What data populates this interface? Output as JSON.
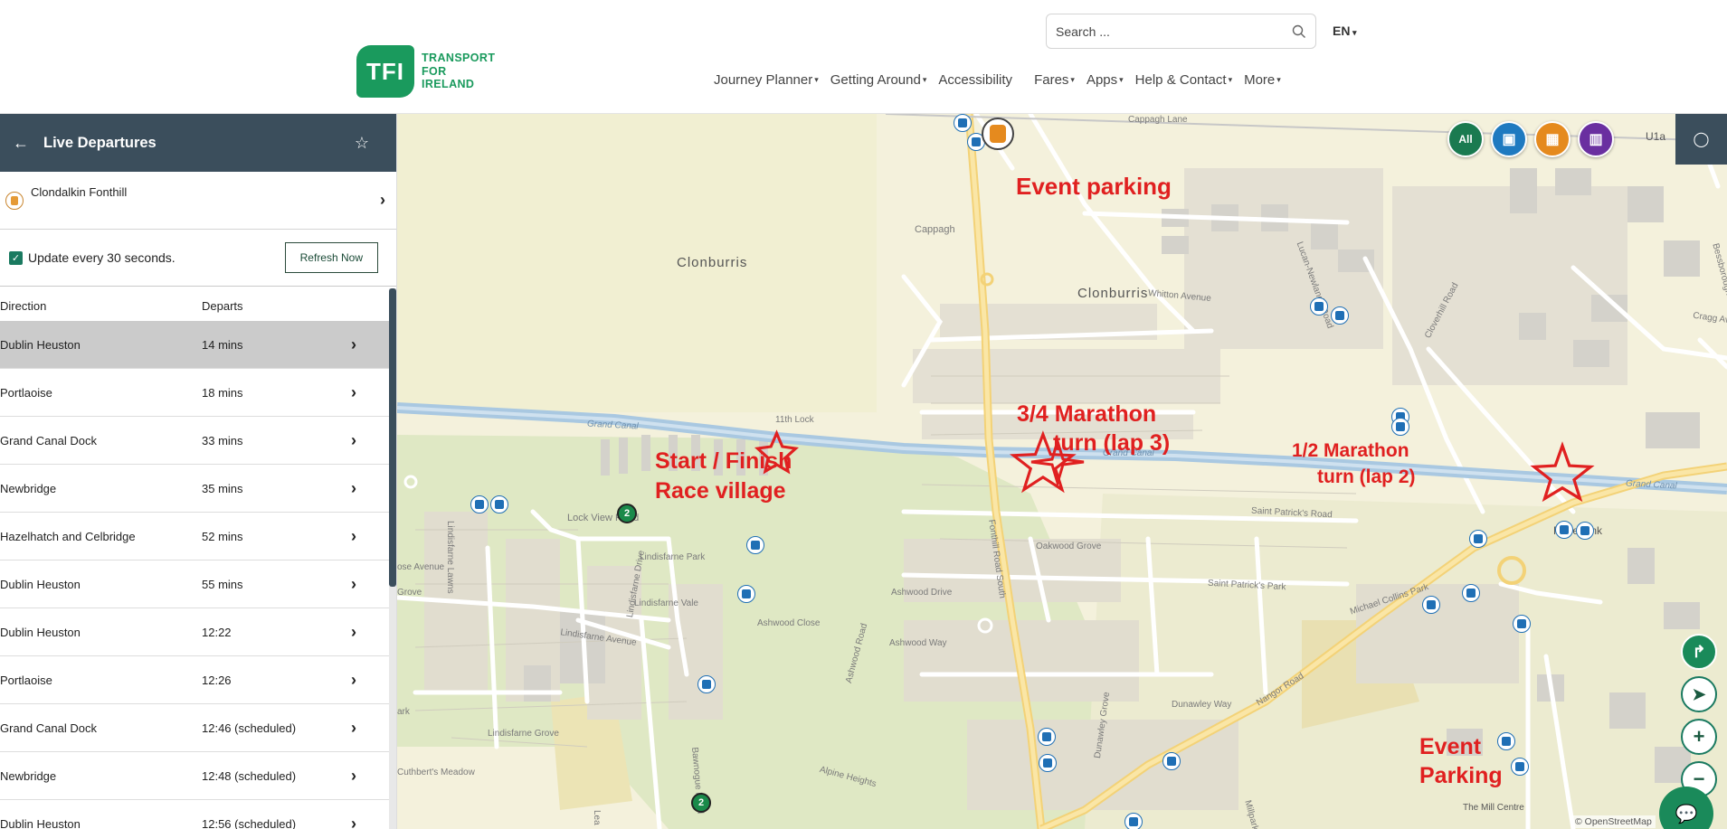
{
  "header": {
    "logo_badge": "TFI",
    "logo_lines": [
      "TRANSPORT",
      "FOR",
      "IRELAND"
    ],
    "search_placeholder": "Search ...",
    "language": "EN",
    "nav": [
      "Journey Planner",
      "Getting Around",
      "Accessibility",
      "Fares",
      "Apps",
      "Help & Contact",
      "More"
    ],
    "nav_has_caret": [
      true,
      true,
      false,
      true,
      true,
      true,
      true
    ]
  },
  "panel": {
    "title": "Live Departures",
    "stop_name": "Clondalkin Fonthill",
    "update_label": "Update every 30 seconds.",
    "refresh_label": "Refresh Now",
    "col_direction": "Direction",
    "col_departs": "Departs",
    "departures": [
      {
        "direction": "Dublin Heuston",
        "departs": "14 mins"
      },
      {
        "direction": "Portlaoise",
        "departs": "18 mins"
      },
      {
        "direction": "Grand Canal Dock",
        "departs": "33 mins"
      },
      {
        "direction": "Newbridge",
        "departs": "35 mins"
      },
      {
        "direction": "Hazelhatch and Celbridge",
        "departs": "52 mins"
      },
      {
        "direction": "Dublin Heuston",
        "departs": "55 mins"
      },
      {
        "direction": "Dublin Heuston",
        "departs": "12:22"
      },
      {
        "direction": "Portlaoise",
        "departs": "12:26"
      },
      {
        "direction": "Grand Canal Dock",
        "departs": "12:46 (scheduled)"
      },
      {
        "direction": "Newbridge",
        "departs": "12:48 (scheduled)"
      },
      {
        "direction": "Dublin Heuston",
        "departs": "12:56 (scheduled)"
      }
    ]
  },
  "map": {
    "mode_buttons": [
      {
        "label": "All",
        "color": "#1a7a50"
      },
      {
        "label": "",
        "icon": "bus-icon",
        "color": "#1f7ac0"
      },
      {
        "label": "",
        "icon": "train-icon",
        "color": "#e58a1e"
      },
      {
        "label": "",
        "icon": "tram-icon",
        "color": "#6a2fa0"
      }
    ],
    "annotations": {
      "event_parking_top": "Event parking",
      "three_quarter_l1": "3/4 Marathon",
      "three_quarter_l2": "turn (lap 3)",
      "half_l1": "1/2 Marathon",
      "half_l2": "turn (lap 2)",
      "start_l1": "Start / Finish",
      "start_l2": "Race village",
      "event_parking_bottom_l1": "Event",
      "event_parking_bottom_l2": "Parking"
    },
    "area_labels": [
      "Clonburris",
      "Clonburris",
      "Cappagh",
      "Rosebank"
    ],
    "street_labels": [
      "Grand Canal",
      "Grand Canal",
      "Grand Canal",
      "11th Lock",
      "Lock View Road",
      "Lindisfarne Park",
      "Lindisfarne Vale",
      "Lindisfarne Avenue",
      "Lindisfarne Grove",
      "Lindisfarne Lawns",
      "Lindisfarne Drive",
      "Ashwood Close",
      "Ashwood Drive",
      "Ashwood Way",
      "Ashwood Road",
      "Oakwood Grove",
      "Saint Patrick's Road",
      "Saint Patrick's Park",
      "Whitton Avenue",
      "Lucan-Newlands Road",
      "Cloverhill Road",
      "Fonthill Road South",
      "Cappagh Lane",
      "Nangor Road",
      "Michael Collins Park",
      "Dunawley Way",
      "Dunawley Grove",
      "Alpine Heights",
      "Cuthbert's Meadow",
      "Bawnogue Road",
      "Bessborough Drive",
      "Cragg Avenue",
      "The Mill Centre",
      "ose Avenue",
      "Grove",
      "ark",
      "U1a",
      "Millpark",
      "Lea"
    ],
    "stop_badge": "2",
    "attribution": "© OpenStreetMap"
  }
}
